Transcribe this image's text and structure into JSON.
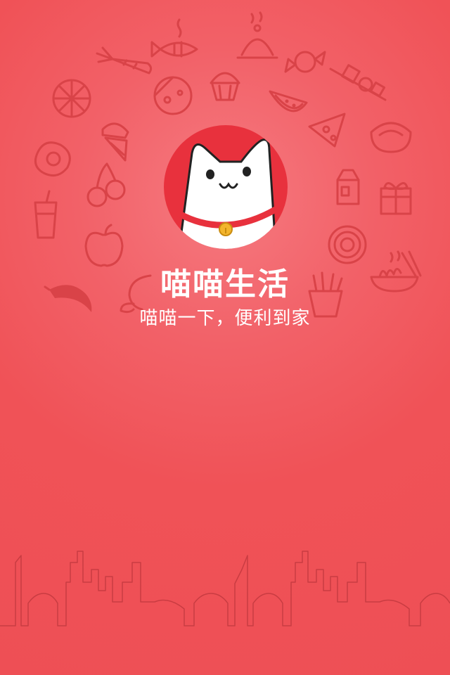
{
  "app": {
    "title": "喵喵生活",
    "slogan": "喵喵一下，便利到家"
  },
  "icons": {
    "logo": "cat-mascot-icon",
    "background": [
      "fish-icon",
      "dish-cover-icon",
      "carrot-icon",
      "candy-icon",
      "kebab-icon",
      "lemon-icon",
      "cheese-icon",
      "cupcake-icon",
      "watermelon-icon",
      "pizza-icon",
      "dumpling-icon",
      "ice-cream-icon",
      "egg-icon",
      "cherry-icon",
      "milk-icon",
      "gift-icon",
      "drink-cup-icon",
      "apple-icon",
      "donut-icon",
      "noodles-icon",
      "chili-icon",
      "shrimp-icon",
      "fries-icon"
    ],
    "skyline": "city-skyline-icon"
  },
  "colors": {
    "background": "#f05257",
    "glow": "#f57a80",
    "logo_circle": "#e8313d",
    "collar": "#e8313d",
    "bell": "#f3b52c",
    "text": "#ffffff"
  }
}
